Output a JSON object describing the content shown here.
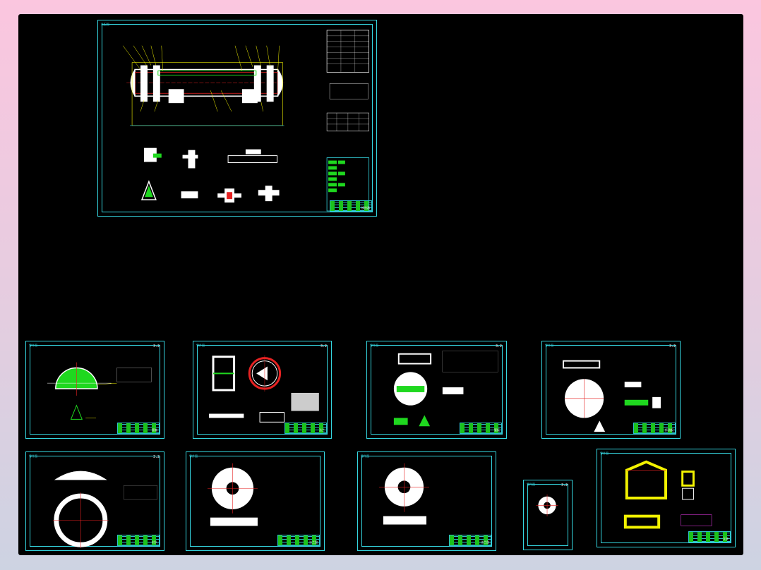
{
  "viewer": {
    "background": "#000000",
    "frame_color": "#35d6e0"
  },
  "main_sheet": {
    "label": "装配图",
    "tech_requirements_title": "技术要求",
    "parts_list_title": "明细表",
    "title_block_name": "换热器"
  },
  "sheets": [
    {
      "id": "a",
      "label": "零件图",
      "tag": "3.2",
      "tb": "管箱"
    },
    {
      "id": "b",
      "label": "零件图",
      "tag": "3.2",
      "tb": "法兰"
    },
    {
      "id": "c",
      "label": "零件图",
      "tag": "3.2",
      "tb": "管板"
    },
    {
      "id": "d",
      "label": "零件图",
      "tag": "3.2",
      "tb": "折流板"
    },
    {
      "id": "e",
      "label": "零件图",
      "tag": "3.2",
      "tb": "封头"
    },
    {
      "id": "f",
      "label": "零件图",
      "tag": "",
      "tb": "法兰盘"
    },
    {
      "id": "g",
      "label": "零件图",
      "tag": "",
      "tb": "法兰盘"
    },
    {
      "id": "h",
      "label": "零件图",
      "tag": "3.2",
      "tb": "垫片"
    },
    {
      "id": "i",
      "label": "零件图",
      "tag": "",
      "tb": "支座"
    }
  ],
  "colors": {
    "outline": "#ffffff",
    "accent_green": "#1fd81f",
    "accent_yellow": "#f2f200",
    "center_line": "#e62222",
    "dimension": "#35d6e0",
    "leader": "#f2f200",
    "magenta_note": "#ff40ff"
  }
}
